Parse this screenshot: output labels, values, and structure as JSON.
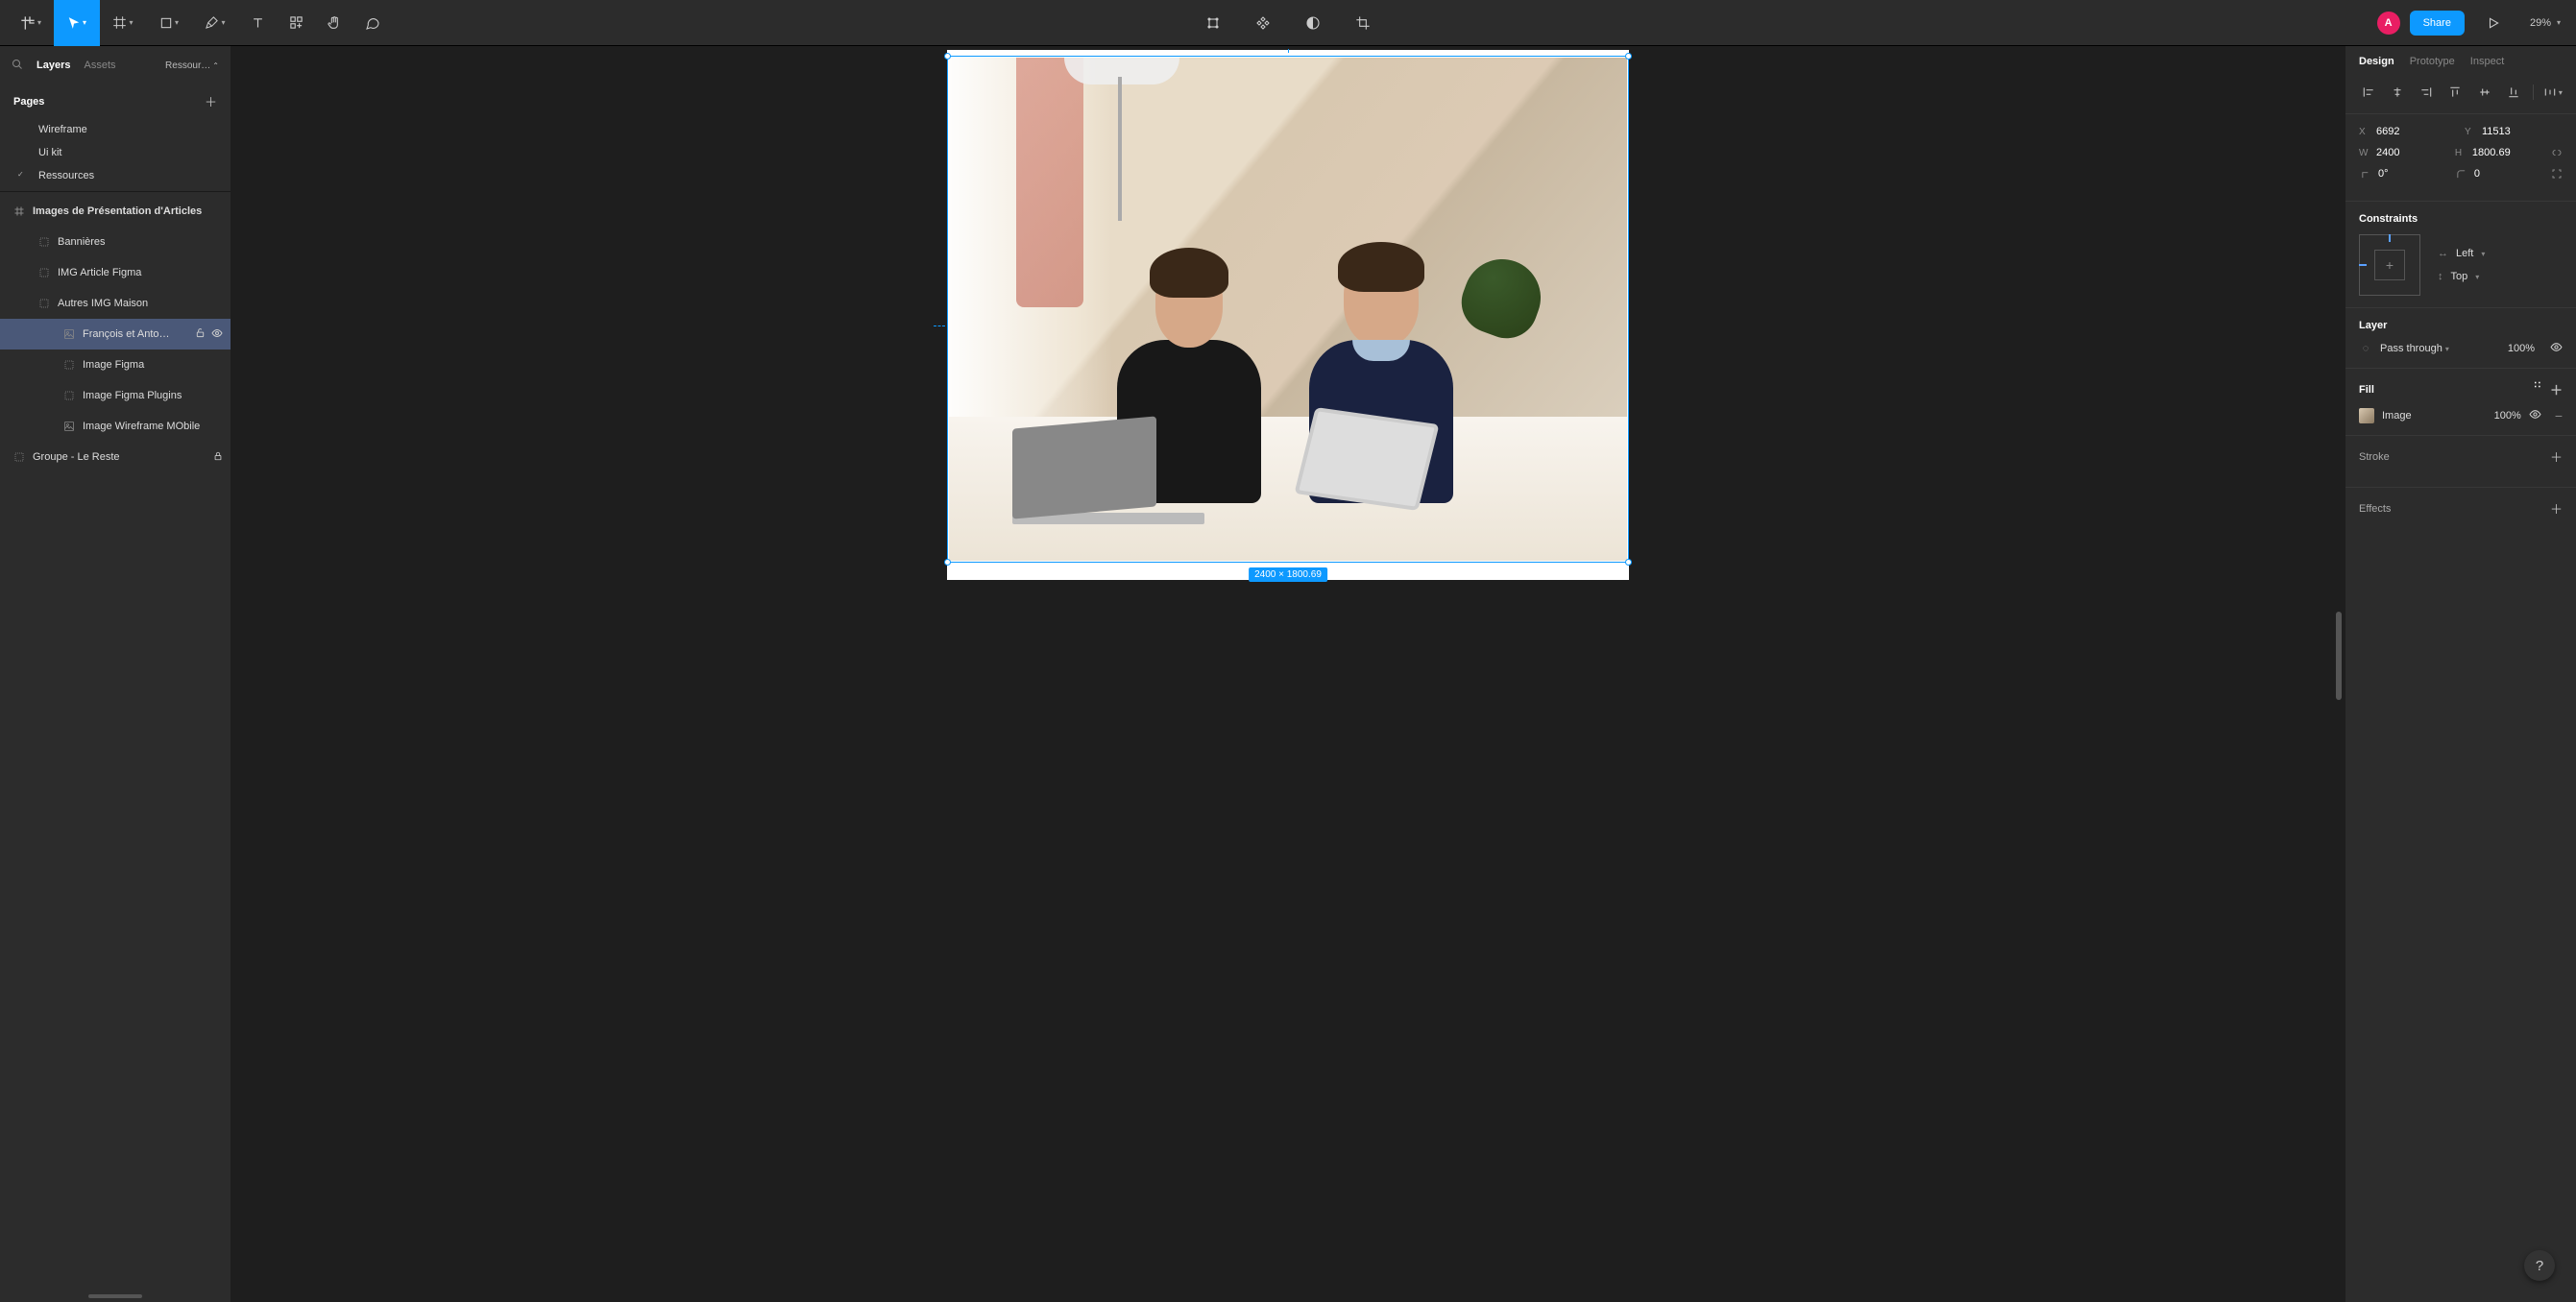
{
  "toolbar": {
    "share_label": "Share",
    "zoom": "29%",
    "avatar_initial": "A"
  },
  "left": {
    "tabs": {
      "layers": "Layers",
      "assets": "Assets",
      "resources": "Ressour…"
    },
    "pages_label": "Pages",
    "pages": [
      {
        "label": "Wireframe"
      },
      {
        "label": "Ui kit"
      },
      {
        "label": "Ressources",
        "expanded": true
      }
    ],
    "frame_label": "Images de Présentation d'Articles",
    "layers": [
      {
        "label": "Bannières",
        "type": "frame"
      },
      {
        "label": "IMG Article Figma",
        "type": "frame"
      },
      {
        "label": "Autres IMG Maison",
        "type": "frame"
      },
      {
        "label": "François et Anto…",
        "type": "image",
        "selected": true,
        "indent": 2
      },
      {
        "label": "Image Figma",
        "type": "frame",
        "indent": 2
      },
      {
        "label": "Image Figma Plugins",
        "type": "frame",
        "indent": 2
      },
      {
        "label": "Image Wireframe MObile",
        "type": "image",
        "indent": 2
      }
    ],
    "group_label": "Groupe - Le Reste"
  },
  "canvas": {
    "dimensions_badge": "2400 × 1800.69"
  },
  "right": {
    "tabs": {
      "design": "Design",
      "prototype": "Prototype",
      "inspect": "Inspect"
    },
    "x_label": "X",
    "x": "6692",
    "y_label": "Y",
    "y": "11513",
    "w_label": "W",
    "w": "2400",
    "h_label": "H",
    "h": "1800.69",
    "rot": "0°",
    "radius": "0",
    "constraints_label": "Constraints",
    "constraint_h": "Left",
    "constraint_v": "Top",
    "layer_label": "Layer",
    "blend": "Pass through",
    "opacity": "100%",
    "fill_label": "Fill",
    "fill_type": "Image",
    "fill_opacity": "100%",
    "stroke_label": "Stroke",
    "effects_label": "Effects"
  }
}
